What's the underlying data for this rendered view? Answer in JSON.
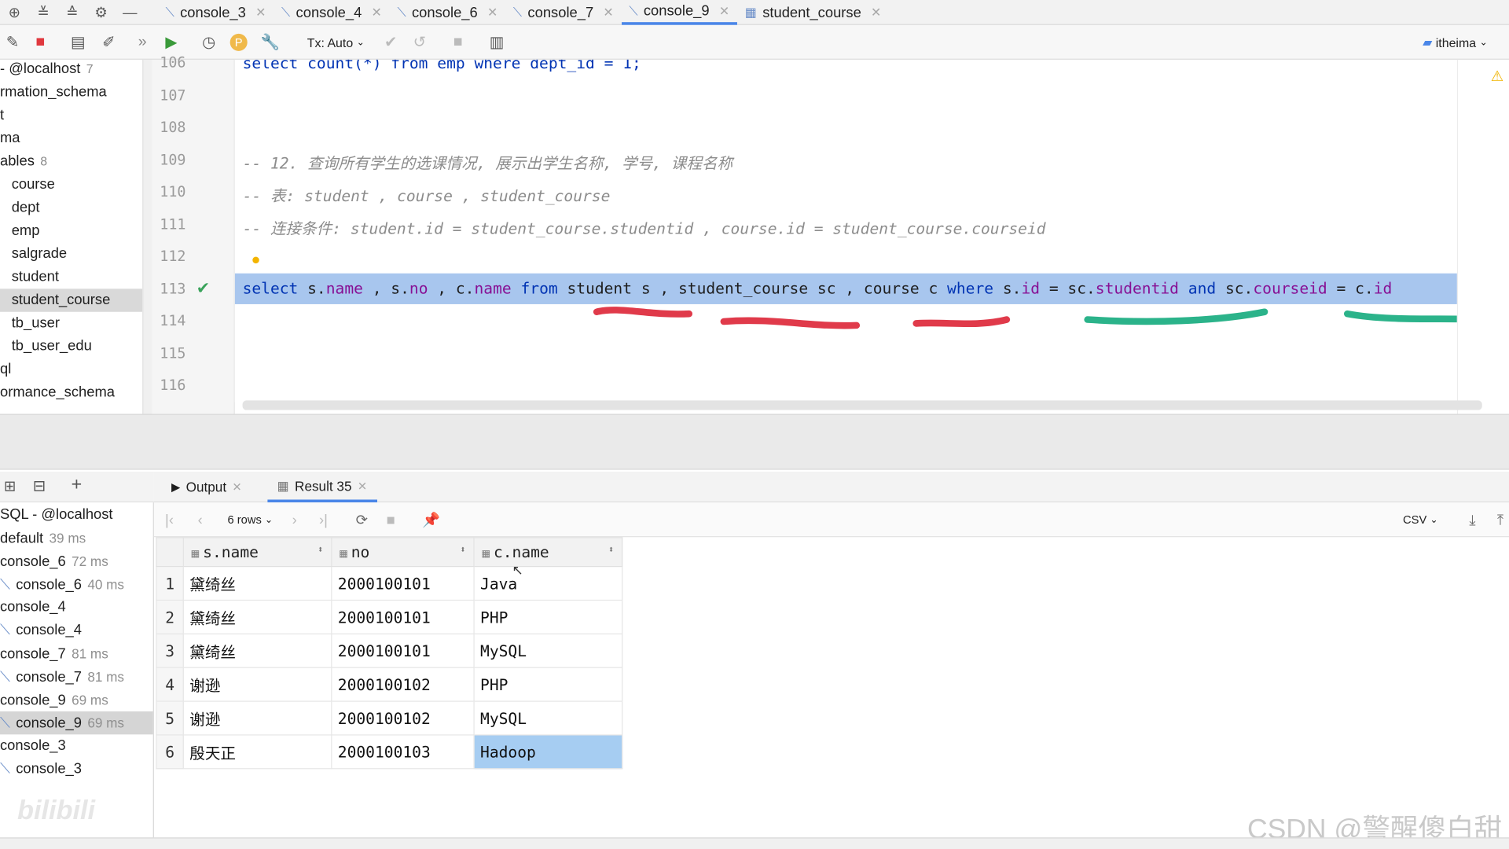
{
  "tabs": [
    {
      "label": "console_3",
      "active": false,
      "icon": "console-icon"
    },
    {
      "label": "console_4",
      "active": false,
      "icon": "console-icon"
    },
    {
      "label": "console_6",
      "active": false,
      "icon": "console-icon"
    },
    {
      "label": "console_7",
      "active": false,
      "icon": "console-icon"
    },
    {
      "label": "console_9",
      "active": true,
      "icon": "console-icon"
    },
    {
      "label": "student_course",
      "active": false,
      "icon": "table-icon"
    }
  ],
  "toolbar": {
    "tx_mode": "Tx: Auto",
    "profile": "itheima"
  },
  "tree": [
    {
      "label": "- @localhost",
      "count": "7"
    },
    {
      "label": "rmation_schema",
      "count": ""
    },
    {
      "label": "t",
      "count": ""
    },
    {
      "label": "ma",
      "count": ""
    },
    {
      "label": "ables",
      "count": "8"
    },
    {
      "label": "course",
      "count": ""
    },
    {
      "label": "dept",
      "count": ""
    },
    {
      "label": "emp",
      "count": ""
    },
    {
      "label": "salgrade",
      "count": ""
    },
    {
      "label": "student",
      "count": ""
    },
    {
      "label": "student_course",
      "count": ""
    },
    {
      "label": "tb_user",
      "count": ""
    },
    {
      "label": "tb_user_edu",
      "count": ""
    },
    {
      "label": "ql",
      "count": ""
    },
    {
      "label": "ormance_schema",
      "count": ""
    }
  ],
  "editor": {
    "line_numbers": [
      "106",
      "107",
      "108",
      "109",
      "110",
      "111",
      "112",
      "113",
      "114",
      "115",
      "116"
    ],
    "line_106": "select count(*) from emp where dept_id = 1;",
    "comment_109": "-- 12. 查询所有学生的选课情况, 展示出学生名称, 学号, 课程名称",
    "comment_110": "-- 表: student , course , student_course",
    "comment_111": "-- 连接条件: student.id = student_course.studentid , course.id = student_course.courseid",
    "sql_113": {
      "t1": "select",
      "t2": " s.",
      "t3": "name",
      "t4": " , s.",
      "t5": "no",
      "t6": " , c.",
      "t7": "name",
      "t8": "from",
      "t9": " student s , student_course sc , course c ",
      "t10": "where",
      "t11": " s.",
      "t12": "id",
      "t13": " = sc.",
      "t14": "studentid",
      "t15": "and",
      "t16": " sc.",
      "t17": "courseid",
      "t18": " = c.",
      "t19": "id"
    }
  },
  "services": [
    {
      "label": "SQL - @localhost",
      "time": ""
    },
    {
      "label": "default",
      "time": "39 ms"
    },
    {
      "label": "console_6",
      "time": "72 ms"
    },
    {
      "label": "console_6",
      "time": "40 ms"
    },
    {
      "label": "console_4",
      "time": ""
    },
    {
      "label": "console_4",
      "time": ""
    },
    {
      "label": "console_7",
      "time": "81 ms"
    },
    {
      "label": "console_7",
      "time": "81 ms"
    },
    {
      "label": "console_9",
      "time": "69 ms"
    },
    {
      "label": "console_9",
      "time": "69 ms"
    },
    {
      "label": "console_3",
      "time": ""
    },
    {
      "label": "console_3",
      "time": ""
    }
  ],
  "result": {
    "output_tab": "Output",
    "result_tab": "Result 35",
    "rows_label": "6 rows",
    "export_format": "CSV",
    "columns": [
      "s.name",
      "no",
      "c.name"
    ],
    "rows": [
      [
        "1",
        "黛绮丝",
        "2000100101",
        "Java"
      ],
      [
        "2",
        "黛绮丝",
        "2000100101",
        "PHP"
      ],
      [
        "3",
        "黛绮丝",
        "2000100101",
        "MySQL"
      ],
      [
        "4",
        "谢逊",
        "2000100102",
        "PHP"
      ],
      [
        "5",
        "谢逊",
        "2000100102",
        "MySQL"
      ],
      [
        "6",
        "殷天正",
        "2000100103",
        "Hadoop"
      ]
    ]
  },
  "watermark": "CSDN @警醒傻白甜",
  "colors": {
    "accent": "#4a86e8",
    "selection": "#a8c6ee",
    "keyword": "#0033b3",
    "field": "#871094",
    "red_mark": "#e03a4a",
    "green_mark": "#2bb38a"
  }
}
